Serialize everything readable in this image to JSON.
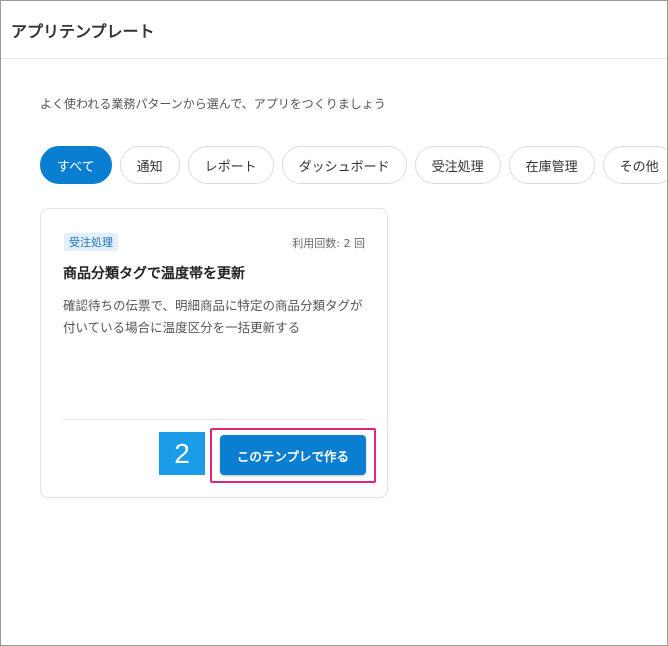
{
  "header": {
    "title": "アプリテンプレート"
  },
  "intro": {
    "text": "よく使われる業務パターンから選んで、アプリをつくりましょう"
  },
  "filters": {
    "items": [
      {
        "label": "すべて",
        "active": true
      },
      {
        "label": "通知",
        "active": false
      },
      {
        "label": "レポート",
        "active": false
      },
      {
        "label": "ダッシュボード",
        "active": false
      },
      {
        "label": "受注処理",
        "active": false
      },
      {
        "label": "在庫管理",
        "active": false
      },
      {
        "label": "その他",
        "active": false
      }
    ]
  },
  "card": {
    "tag": "受注処理",
    "usage": "利用回数: 2 回",
    "title": "商品分類タグで温度帯を更新",
    "description": "確認待ちの伝票で、明細商品に特定の商品分類タグが付いている場合に温度区分を一括更新する",
    "create_button_label": "このテンプレで作る"
  },
  "annotation": {
    "step_number": "2"
  },
  "colors": {
    "accent": "#0a7ed0",
    "highlight": "#e0267a",
    "step_badge": "#1a9ce8"
  }
}
